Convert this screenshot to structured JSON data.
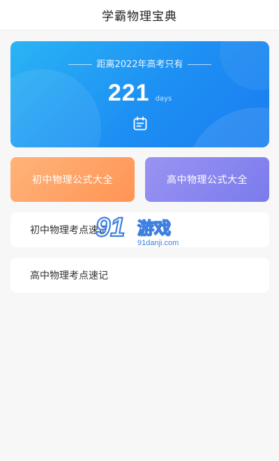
{
  "header": {
    "title": "学霸物理宝典"
  },
  "countdown": {
    "title": "距离2022年高考只有",
    "days": "221",
    "unit": "days",
    "icon": "calendar-icon"
  },
  "formulas": {
    "junior_label": "初中物理公式大全",
    "senior_label": "高中物理公式大全"
  },
  "notes": [
    {
      "label": "初中物理考点速记"
    },
    {
      "label": "高中物理考点速记"
    }
  ],
  "watermark": {
    "brand": "游戏",
    "mark": "91",
    "domain": "91danji.com"
  },
  "colors": {
    "card_blue": "#1d8ff3",
    "junior_orange": "#ff9454",
    "senior_purple": "#7a7bec",
    "background": "#f7f7f7"
  }
}
